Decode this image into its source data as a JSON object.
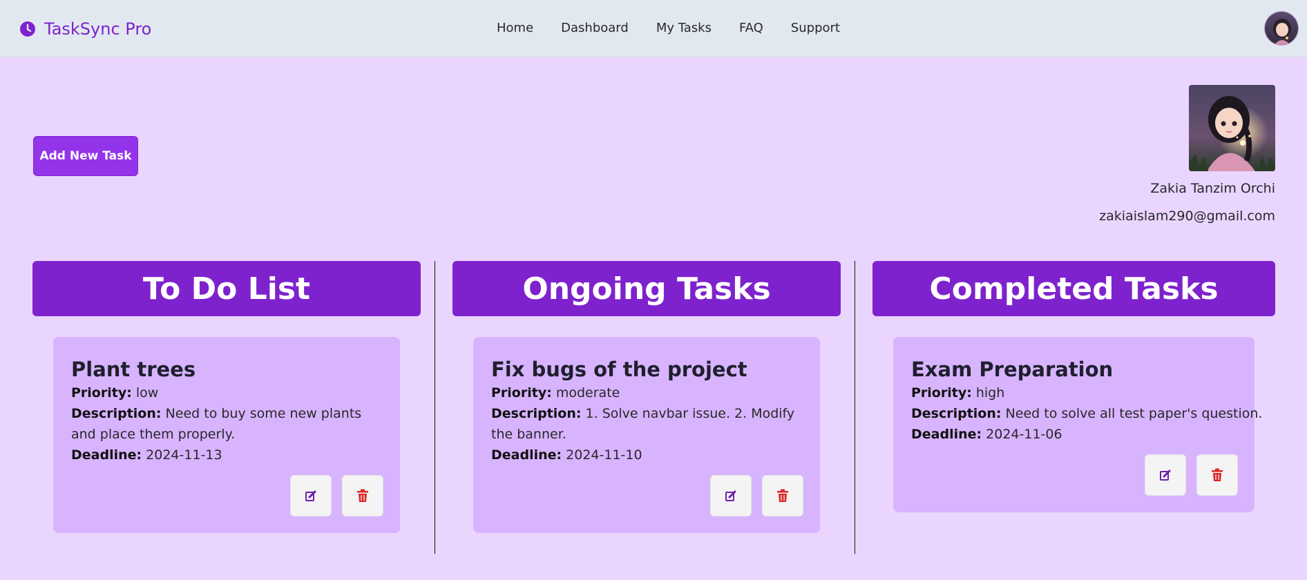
{
  "nav": {
    "brand": "TaskSync Pro",
    "links": [
      "Home",
      "Dashboard",
      "My Tasks",
      "FAQ",
      "Support"
    ],
    "brand_icon": "clock-icon",
    "avatar_icon": "user-avatar"
  },
  "actions": {
    "add_task_label": "Add New Task"
  },
  "profile": {
    "name": "Zakia Tanzim Orchi",
    "email": "zakiaislam290@gmail.com"
  },
  "columns": [
    {
      "title": "To Do List",
      "task": {
        "title": "Plant trees",
        "priority_label": "Priority:",
        "priority": "low",
        "description_label": "Description:",
        "description": "Need to buy some new plants and place them properly.",
        "deadline_label": "Deadline:",
        "deadline": "2024-11-13"
      }
    },
    {
      "title": "Ongoing Tasks",
      "task": {
        "title": "Fix bugs of the project",
        "priority_label": "Priority:",
        "priority": "moderate",
        "description_label": "Description:",
        "description": "1. Solve navbar issue. 2. Modify the banner.",
        "deadline_label": "Deadline:",
        "deadline": "2024-11-10"
      }
    },
    {
      "title": "Completed Tasks",
      "task": {
        "title": "Exam Preparation",
        "priority_label": "Priority:",
        "priority": "high",
        "description_label": "Description:",
        "description": "Need to solve all test paper's question.",
        "deadline_label": "Deadline:",
        "deadline": "2024-11-06"
      }
    }
  ],
  "colors": {
    "page_bg": "#ead5fe",
    "nav_bg": "#e2e8f0",
    "brand": "#7e22ce",
    "header_bg": "#7e22ce",
    "card_bg": "#d8b4fe",
    "edit_icon": "#6b21a8",
    "delete_icon": "#dc2626"
  }
}
